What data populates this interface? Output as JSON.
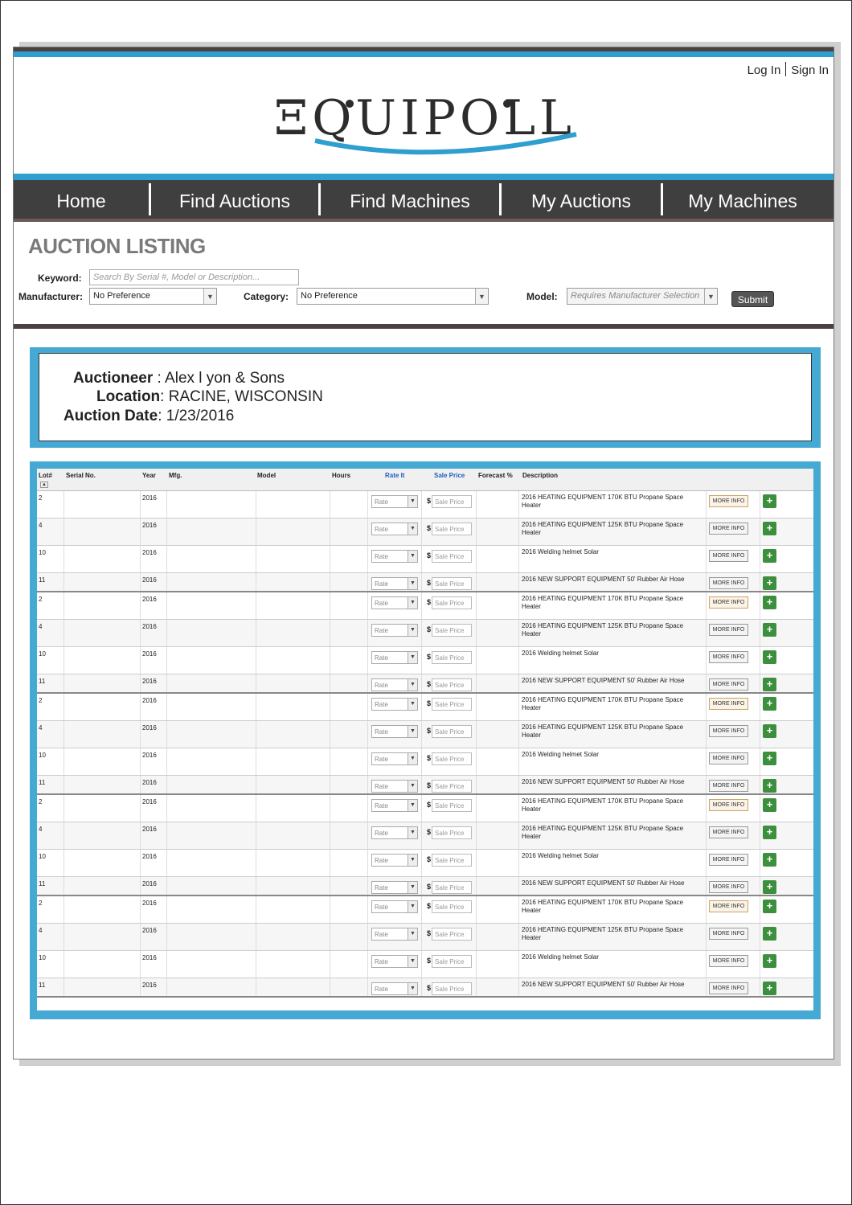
{
  "header": {
    "login_label": "Log In",
    "signin_label": "Sign In",
    "logo_text": "ΞQUIPOLL"
  },
  "nav": {
    "items": [
      {
        "label": "Home"
      },
      {
        "label": "Find Auctions"
      },
      {
        "label": "Find Machines"
      },
      {
        "label": "My Auctions"
      },
      {
        "label": "My Machines"
      }
    ]
  },
  "filters": {
    "title": "AUCTION LISTING",
    "keyword_label": "Keyword:",
    "keyword_placeholder": "Search By Serial #, Model or Description...",
    "manufacturer_label": "Manufacturer:",
    "manufacturer_value": "No Preference",
    "category_label": "Category:",
    "category_value": "No Preference",
    "model_label": "Model:",
    "model_value": "Requires Manufacturer Selection",
    "submit_label": "Submit"
  },
  "auction": {
    "auctioneer_label": "Auctioneer",
    "auctioneer_value": "Alex l yon & Sons",
    "location_label": "Location",
    "location_value": "RACINE, WISCONSIN",
    "date_label": "Auction Date",
    "date_value": "1/23/2016"
  },
  "table": {
    "columns": {
      "lot": "Lot#",
      "serial": "Serial No.",
      "year": "Year",
      "mfg": "Mfg.",
      "model": "Model",
      "hours": "Hours",
      "rate": "Rate It",
      "sale_price": "Sale Price",
      "forecast": "Forecast %",
      "description": "Description"
    },
    "rate_placeholder": "Rate",
    "price_placeholder": "Sale Price",
    "currency": "$",
    "more_info_label": "MORE INFO",
    "add_label": "+",
    "rows": [
      {
        "lot": "2",
        "year": "2016",
        "description": "2016 HEATING EQUIPMENT 170K BTU Propane Space Heater"
      },
      {
        "lot": "4",
        "year": "2016",
        "description": "2016 HEATING EQUIPMENT 125K BTU Propane Space Heater"
      },
      {
        "lot": "10",
        "year": "2016",
        "description": "2016 Welding helmet Solar"
      },
      {
        "lot": "11",
        "year": "2016",
        "description": "2016 NEW SUPPORT EQUIPMENT 50' Rubber Air Hose"
      },
      {
        "lot": "2",
        "year": "2016",
        "description": "2016 HEATING EQUIPMENT 170K BTU Propane Space Heater"
      },
      {
        "lot": "4",
        "year": "2016",
        "description": "2016 HEATING EQUIPMENT 125K BTU Propane Space Heater"
      },
      {
        "lot": "10",
        "year": "2016",
        "description": "2016 Welding helmet Solar"
      },
      {
        "lot": "11",
        "year": "2016",
        "description": "2016 NEW SUPPORT EQUIPMENT 50' Rubber Air Hose"
      },
      {
        "lot": "2",
        "year": "2016",
        "description": "2016 HEATING EQUIPMENT 170K BTU Propane Space Heater"
      },
      {
        "lot": "4",
        "year": "2016",
        "description": "2016 HEATING EQUIPMENT 125K BTU Propane Space Heater"
      },
      {
        "lot": "10",
        "year": "2016",
        "description": "2016 Welding helmet Solar"
      },
      {
        "lot": "11",
        "year": "2016",
        "description": "2016 NEW SUPPORT EQUIPMENT 50' Rubber Air Hose"
      },
      {
        "lot": "2",
        "year": "2016",
        "description": "2016 HEATING EQUIPMENT 170K BTU Propane Space Heater"
      },
      {
        "lot": "4",
        "year": "2016",
        "description": "2016 HEATING EQUIPMENT 125K BTU Propane Space Heater"
      },
      {
        "lot": "10",
        "year": "2016",
        "description": "2016 Welding helmet Solar"
      },
      {
        "lot": "11",
        "year": "2016",
        "description": "2016 NEW SUPPORT EQUIPMENT 50' Rubber Air Hose"
      },
      {
        "lot": "2",
        "year": "2016",
        "description": "2016 HEATING EQUIPMENT 170K BTU Propane Space Heater"
      },
      {
        "lot": "4",
        "year": "2016",
        "description": "2016 HEATING EQUIPMENT 125K BTU Propane Space Heater"
      },
      {
        "lot": "10",
        "year": "2016",
        "description": "2016 Welding helmet Solar"
      },
      {
        "lot": "11",
        "year": "2016",
        "description": "2016 NEW SUPPORT EQUIPMENT 50' Rubber Air Hose"
      }
    ]
  },
  "colors": {
    "accent_blue": "#2f9fcf",
    "nav_bg": "#3f3f3f",
    "add_green": "#3c8f3c"
  }
}
